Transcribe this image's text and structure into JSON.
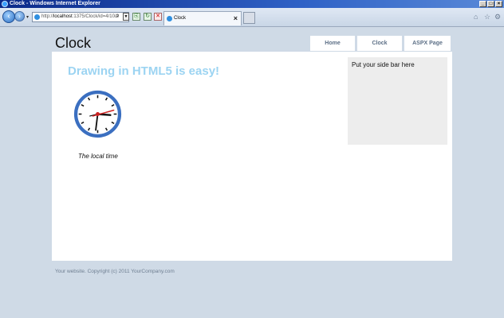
{
  "window": {
    "title": "Clock - Windows Internet Explorer",
    "controls": [
      "_",
      "□",
      "×"
    ]
  },
  "browser": {
    "back_icon": "back-arrow-icon",
    "forward_icon": "forward-arrow-icon",
    "address": {
      "prefix": "http://",
      "host": "localhost",
      "rest": ":1375/Clock/id=4/10/2"
    },
    "tab": {
      "label": "Clock",
      "close": "×"
    }
  },
  "site": {
    "title": "Clock",
    "menu": [
      "Home",
      "Clock",
      "ASPX Page"
    ],
    "heading": "Drawing in HTML5 is easy!",
    "sidebar_text": "Put your side bar here",
    "clock_caption": "The local time",
    "footer": "Your website. Copyright (c) 2011 YourCompany.com"
  },
  "colors": {
    "page_bg": "#cfdae6",
    "heading": "#9cd4f2",
    "clock_ring": "#3b6fc0",
    "second_hand": "#cc2222"
  }
}
